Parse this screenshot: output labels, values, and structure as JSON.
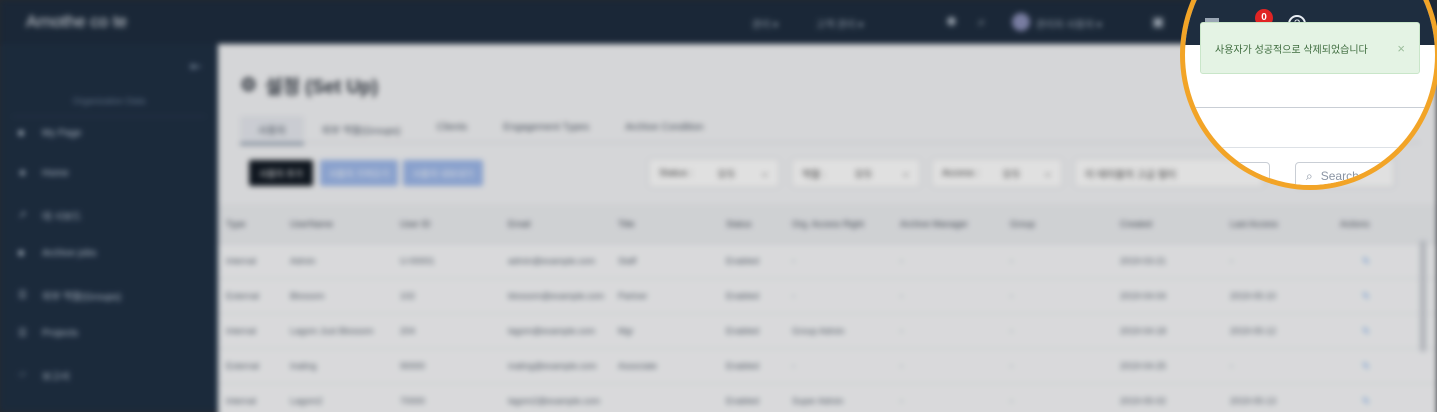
{
  "topbar": {
    "brand": "Arnothe co te",
    "link1": "관리 ▾",
    "link2": "고객 관리 ▾",
    "user_name": "관리자 사용자 ▾",
    "notification_count": "0",
    "help_glyph": "?"
  },
  "sidebar": {
    "org_label": "Organization Data",
    "items": [
      {
        "icon": "home-icon",
        "glyph": "■",
        "label": "My Page"
      },
      {
        "icon": "star-icon",
        "glyph": "★",
        "label": "Home"
      },
      {
        "icon": "chart-icon",
        "glyph": "↗",
        "label": "대 시보드"
      },
      {
        "icon": "folder-icon",
        "glyph": "■",
        "label": "Archive jobs"
      },
      {
        "icon": "users-icon",
        "glyph": "☰",
        "label": "외부 역할(Groups)"
      },
      {
        "icon": "project-icon",
        "glyph": "☰",
        "label": "Projects"
      },
      {
        "icon": "report-icon",
        "glyph": "☞",
        "label": "보고서"
      }
    ]
  },
  "page": {
    "title": "설정 (Set Up)",
    "tabs": [
      "사용자",
      "외부 역할(Groups)",
      "Clients",
      "Engagement Types",
      "Archive Condition"
    ],
    "buttons": {
      "add": "사용자 추가",
      "import": "사용자 가져오기",
      "export": "사용자 내보내기"
    },
    "filters": [
      {
        "label": "Status :",
        "value": "모두"
      },
      {
        "label": "역할 :",
        "value": "모두"
      },
      {
        "label": "Access :",
        "value": "모두"
      }
    ],
    "filter_text": "이 테이블의 고급 필터",
    "search_placeholder": "Search"
  },
  "table": {
    "headers": [
      "Type",
      "UserName",
      "User ID",
      "Email",
      "Title",
      "Status",
      "Org. Access Right",
      "Archive Manager",
      "Group",
      "Created",
      "Last Access",
      "Actions"
    ],
    "rows": [
      [
        "Internal",
        "Admin",
        "U-00001",
        "admin@example.com",
        "Staff",
        "Enabled",
        "-",
        "-",
        "-",
        "2019-03-21",
        "-",
        "✎"
      ],
      [
        "External",
        "Blossom",
        "102",
        "blossom@example.com",
        "Partner",
        "Enabled",
        "-",
        "-",
        "-",
        "2019-04-04",
        "2019-05-10",
        "✎"
      ],
      [
        "Internal",
        "Lagom Just Blossom",
        "204",
        "lagom@example.com",
        "Mgr",
        "Enabled",
        "Group Admin",
        "-",
        "-",
        "2019-04-18",
        "2019-05-12",
        "✎"
      ],
      [
        "External",
        "Inaling",
        "90000",
        "inaling@example.com",
        "Associate",
        "Enabled",
        "-",
        "-",
        "-",
        "2019-04-25",
        "-",
        "✎"
      ],
      [
        "Internal",
        "Lagom2",
        "70000",
        "lagom2@example.com",
        "",
        "Enabled",
        "Super Admin",
        "-",
        "-",
        "2019-05-02",
        "2019-05-13",
        "✎"
      ]
    ]
  },
  "toast": {
    "message": "사용자가 성공적으로 삭제되었습니다",
    "close_glyph": "×"
  },
  "colors": {
    "topbar": "#1e2d3f",
    "sidebar": "#1f3044",
    "lens_border": "#f2a427",
    "toast_bg": "#e4f3e4",
    "badge": "#e02424"
  }
}
